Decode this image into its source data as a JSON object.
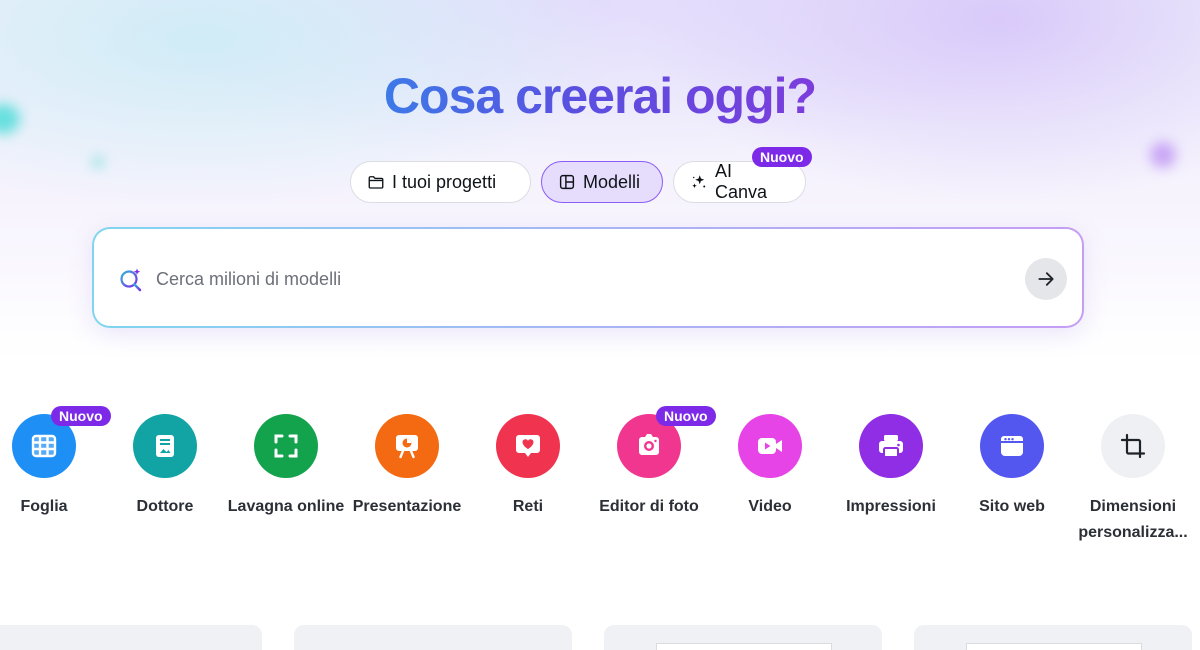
{
  "hero": {
    "title": "Cosa creerai oggi?"
  },
  "tabs": {
    "projects": {
      "label": "I tuoi progetti",
      "icon": "folder-icon"
    },
    "templates": {
      "label": "Modelli",
      "icon": "template-icon",
      "selected": true
    },
    "ai": {
      "label": "AI Canva",
      "icon": "sparkle-icon",
      "badge": "Nuovo"
    }
  },
  "search": {
    "placeholder": "Cerca milioni di modelli",
    "value": "",
    "icon": "magic-search-icon",
    "submit_icon": "arrow-right-icon"
  },
  "shortcuts": [
    {
      "label": "Foglia",
      "icon": "sheet-grid-icon",
      "color": "#1d8ff5",
      "badge": "Nuovo"
    },
    {
      "label": "Dottore",
      "icon": "doc-icon",
      "color": "#12a4a5"
    },
    {
      "label": "Lavagna online",
      "icon": "whiteboard-icon",
      "color": "#13a34d"
    },
    {
      "label": "Presentazione",
      "icon": "presentation-icon",
      "color": "#f46a12"
    },
    {
      "label": "Reti",
      "icon": "heart-chat-icon",
      "color": "#f0344f"
    },
    {
      "label": "Editor di foto",
      "icon": "camera-icon",
      "color": "#f0368f",
      "badge": "Nuovo"
    },
    {
      "label": "Video",
      "icon": "video-icon",
      "color": "#e644e6"
    },
    {
      "label": "Impressioni",
      "icon": "printer-icon",
      "color": "#8f2ee4"
    },
    {
      "label": "Sito web",
      "icon": "website-icon",
      "color": "#5357f0"
    },
    {
      "label": "Dimensioni personalizza...",
      "icon": "crop-icon",
      "color": "#eff0f3"
    }
  ],
  "colors": {
    "accent": "#7d2ae8",
    "selected_tab_bg": "#e6dcfb",
    "text": "#0e1318"
  }
}
